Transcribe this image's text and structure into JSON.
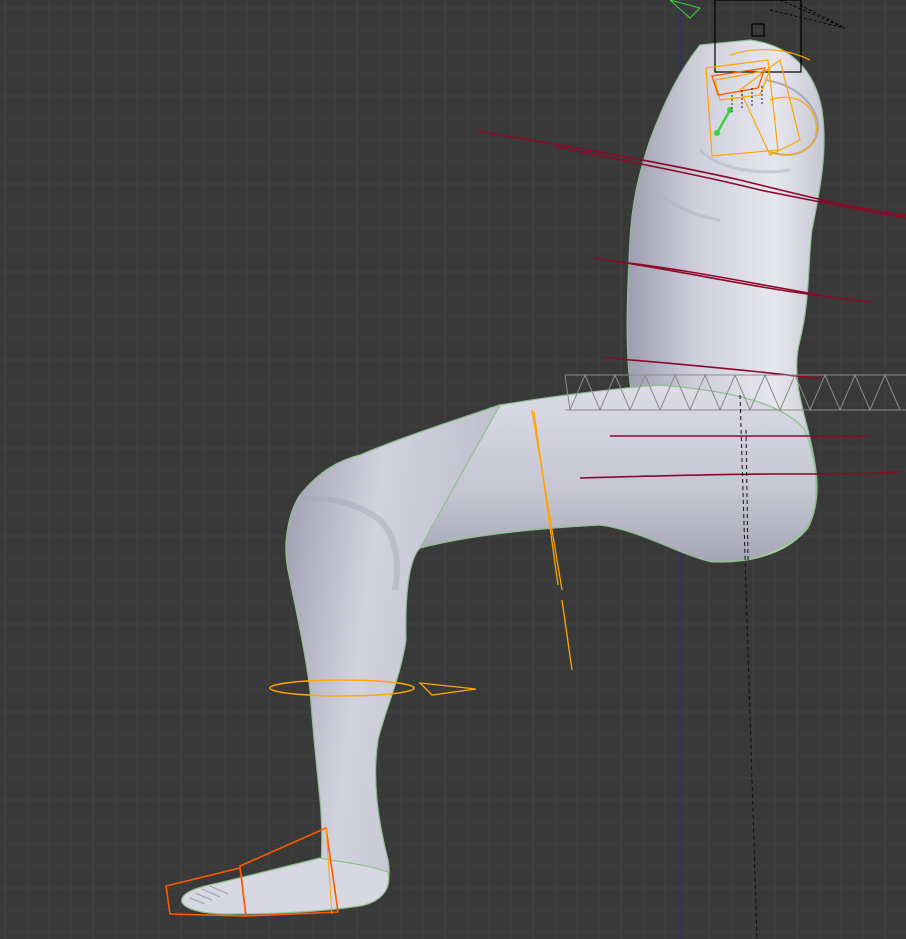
{
  "viewport": {
    "background": "#393939",
    "grid_minor": "#3e3e3e",
    "grid_major": "#444444"
  },
  "colors": {
    "mesh_light": "#e4e4ec",
    "mesh_mid": "#b9b9c8",
    "mesh_dark": "#8d8d9e",
    "mesh_outline": "#8fbf8f",
    "ik_bone": "#ffa500",
    "selected_bone": "#ff5a00",
    "muscle_line": "#8b0a2a",
    "z_axis": "#2a2a8a",
    "wire": "#8a8a8a",
    "dashed": "#111111",
    "active_bone": "#3cd13c",
    "black_bone": "#000000"
  },
  "objects": {
    "mesh": "body-mesh-icon",
    "rig": "armature-icon",
    "axis": "z-axis-icon"
  }
}
